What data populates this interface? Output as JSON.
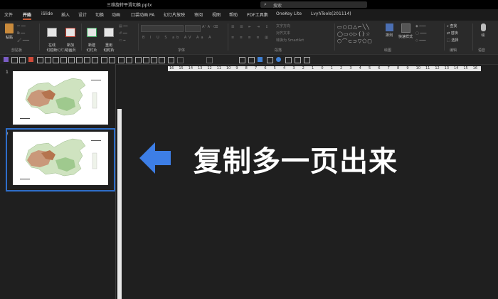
{
  "window": {
    "document_title": "三维旋转平滑切换.pptx",
    "search_placeholder": "搜索"
  },
  "tabs": [
    {
      "label": "文件"
    },
    {
      "label": "开始"
    },
    {
      "label": "iSlide"
    },
    {
      "label": "插入"
    },
    {
      "label": "设计"
    },
    {
      "label": "切换"
    },
    {
      "label": "动画"
    },
    {
      "label": "口袋动画 PA"
    },
    {
      "label": "幻灯片放映"
    },
    {
      "label": "审阅"
    },
    {
      "label": "视图"
    },
    {
      "label": "帮助"
    },
    {
      "label": "PDF工具集"
    },
    {
      "label": "OneKey Lite"
    },
    {
      "label": "LvyhTools(201114)"
    }
  ],
  "ribbon": {
    "paste_label": "粘贴",
    "clipboard_group": "剪贴板",
    "online_slides_label": "在线\n幻灯片",
    "new_animated_label": "新加\n动画页",
    "online_group": "在线幻灯片",
    "new_slide_label": "新建\n幻灯片",
    "reuse_label": "重用\n幻灯片",
    "slides_group": "幻灯片",
    "font_group": "字体",
    "paragraph_group": "段落",
    "text_direction": "文字方向",
    "align_text": "对齐文本",
    "smartart": "转换为 SmartArt",
    "arrange_label": "排列",
    "quick_styles_label": "快速样式",
    "drawing_group": "绘图",
    "find_label": "查找",
    "replace_label": "替换",
    "select_label": "选择",
    "editing_group": "编辑",
    "ink_label": "绘",
    "extra_group": "语音"
  },
  "rulers": {
    "horizontal_ticks": [
      "16",
      "15",
      "14",
      "13",
      "12",
      "11",
      "10",
      "9",
      "8",
      "7",
      "6",
      "5",
      "4",
      "3",
      "2",
      "1",
      "0",
      "1",
      "2",
      "3",
      "4",
      "5",
      "6",
      "7",
      "8",
      "9",
      "10",
      "11",
      "12",
      "13",
      "14",
      "15",
      "16"
    ]
  },
  "slides": [
    {
      "number": "1"
    },
    {
      "number": "2"
    }
  ],
  "annotation": {
    "caption": "复制多一页出来",
    "arrow_color": "#3d7ee6"
  },
  "colors": {
    "selection": "#2e6ec9",
    "tab_underline": "#c75b36"
  }
}
